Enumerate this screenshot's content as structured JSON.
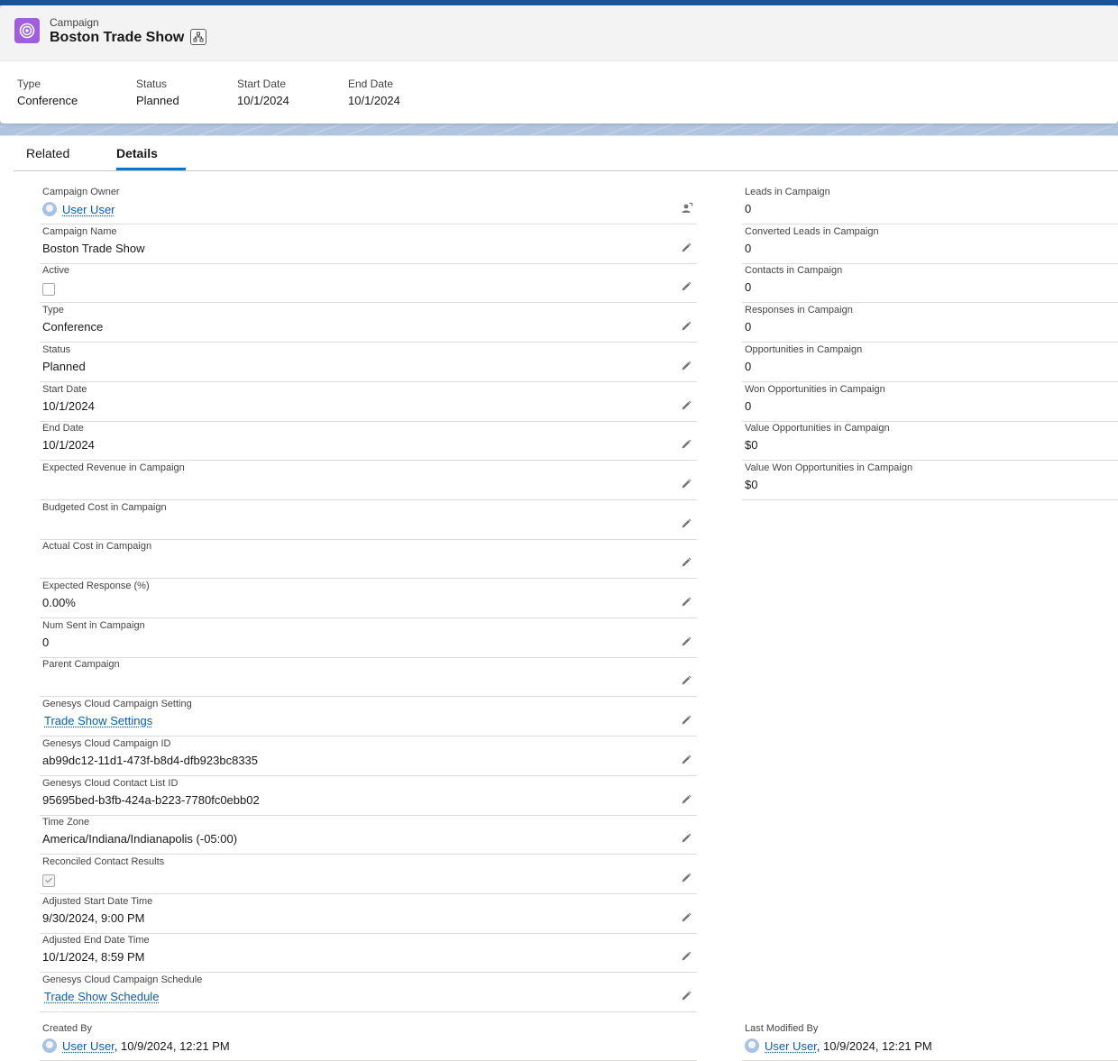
{
  "header": {
    "object_label": "Campaign",
    "title": "Boston Trade Show",
    "object_icon": "campaign-target-icon",
    "highlights": [
      {
        "label": "Type",
        "value": "Conference"
      },
      {
        "label": "Status",
        "value": "Planned"
      },
      {
        "label": "Start Date",
        "value": "10/1/2024"
      },
      {
        "label": "End Date",
        "value": "10/1/2024"
      }
    ]
  },
  "tabs": [
    {
      "label": "Related"
    },
    {
      "label": "Details",
      "active": true
    }
  ],
  "left_fields": [
    {
      "label": "Campaign Owner",
      "value": "User User",
      "kind": "user",
      "action_icon": "change-owner-icon"
    },
    {
      "label": "Campaign Name",
      "value": "Boston Trade Show"
    },
    {
      "label": "Active",
      "kind": "checkbox",
      "checked": false
    },
    {
      "label": "Type",
      "value": "Conference"
    },
    {
      "label": "Status",
      "value": "Planned"
    },
    {
      "label": "Start Date",
      "value": "10/1/2024"
    },
    {
      "label": "End Date",
      "value": "10/1/2024"
    },
    {
      "label": "Expected Revenue in Campaign",
      "value": ""
    },
    {
      "label": "Budgeted Cost in Campaign",
      "value": ""
    },
    {
      "label": "Actual Cost in Campaign",
      "value": ""
    },
    {
      "label": "Expected Response (%)",
      "value": "0.00%"
    },
    {
      "label": "Num Sent in Campaign",
      "value": "0"
    },
    {
      "label": "Parent Campaign",
      "value": ""
    },
    {
      "label": "Genesys Cloud Campaign Setting",
      "value": "Trade Show Settings",
      "kind": "link"
    },
    {
      "label": "Genesys Cloud Campaign ID",
      "value": "ab99dc12-11d1-473f-b8d4-dfb923bc8335"
    },
    {
      "label": "Genesys Cloud Contact List ID",
      "value": "95695bed-b3fb-424a-b223-7780fc0ebb02"
    },
    {
      "label": "Time Zone",
      "value": "America/Indiana/Indianapolis (-05:00)"
    },
    {
      "label": "Reconciled Contact Results",
      "kind": "checkbox",
      "checked": true
    },
    {
      "label": "Adjusted Start Date Time",
      "value": "9/30/2024, 9:00 PM"
    },
    {
      "label": "Adjusted End Date Time",
      "value": "10/1/2024, 8:59 PM"
    },
    {
      "label": "Genesys Cloud Campaign Schedule",
      "value": "Trade Show Schedule",
      "kind": "link"
    }
  ],
  "right_fields": [
    {
      "label": "Leads in Campaign",
      "value": "0"
    },
    {
      "label": "Converted Leads in Campaign",
      "value": "0"
    },
    {
      "label": "Contacts in Campaign",
      "value": "0"
    },
    {
      "label": "Responses in Campaign",
      "value": "0"
    },
    {
      "label": "Opportunities in Campaign",
      "value": "0"
    },
    {
      "label": "Won Opportunities in Campaign",
      "value": "0"
    },
    {
      "label": "Value Opportunities in Campaign",
      "value": "$0"
    },
    {
      "label": "Value Won Opportunities in Campaign",
      "value": "$0"
    }
  ],
  "system_info": {
    "created_by": {
      "label": "Created By",
      "user": "User User",
      "timestamp": ", 10/9/2024, 12:21 PM"
    },
    "last_modified_by": {
      "label": "Last Modified By",
      "user": "User User",
      "timestamp": ", 10/9/2024, 12:21 PM"
    }
  },
  "colors": {
    "brand_blue": "#1b5297",
    "link": "#0b5cab",
    "tab_active": "#0176d3",
    "campaign_icon": "#9f5fdc"
  }
}
